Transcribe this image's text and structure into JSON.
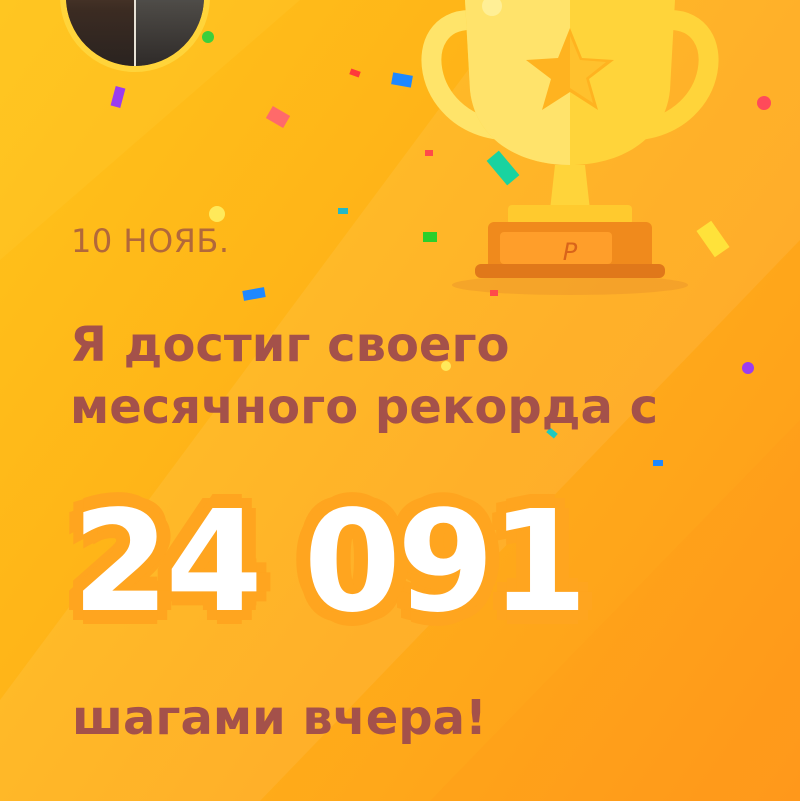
{
  "achievement": {
    "date": "10 НОЯБ.",
    "headline": "Я достиг своего месячного рекорда с",
    "steps_count": "24 091",
    "footer": "шагами вчера!"
  },
  "icons": {
    "trophy": "trophy-icon",
    "badge": "p-logo-icon",
    "avatar": "user-avatar"
  },
  "colors": {
    "background": "#ffb318",
    "headline_text": "#a4514a",
    "date_text": "#b2683a",
    "number_text": "#ffffff",
    "trophy_gold": "#ffd43a"
  }
}
